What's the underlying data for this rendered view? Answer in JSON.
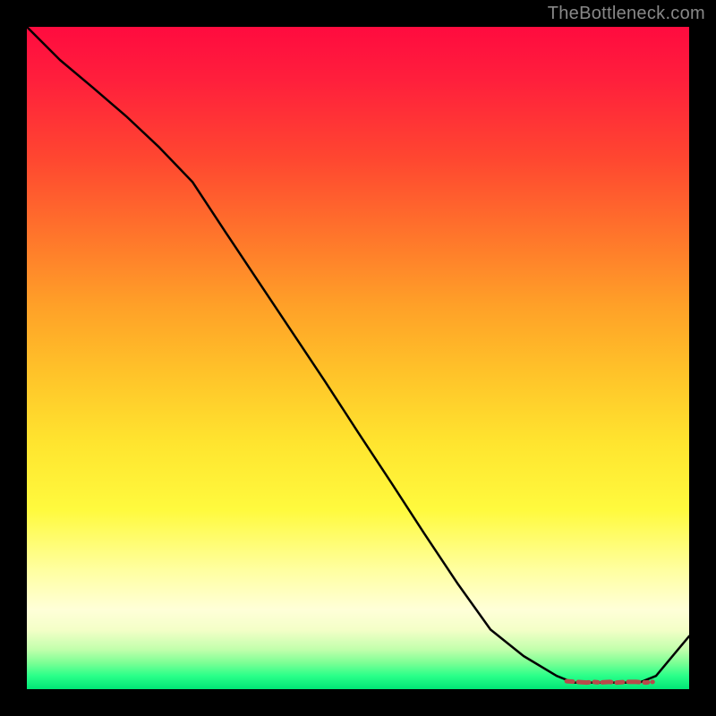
{
  "attribution": "TheBottleneck.com",
  "chart_data": {
    "type": "line",
    "title": "",
    "xlabel": "",
    "ylabel": "",
    "x": [
      0.0,
      0.05,
      0.1,
      0.15,
      0.2,
      0.25,
      0.3,
      0.35,
      0.4,
      0.45,
      0.5,
      0.55,
      0.6,
      0.65,
      0.7,
      0.75,
      0.8,
      0.825,
      0.85,
      0.875,
      0.9,
      0.925,
      0.95,
      1.0
    ],
    "values": [
      1.0,
      0.95,
      0.908,
      0.865,
      0.818,
      0.766,
      0.69,
      0.615,
      0.54,
      0.465,
      0.388,
      0.312,
      0.235,
      0.16,
      0.09,
      0.05,
      0.02,
      0.01,
      0.01,
      0.01,
      0.01,
      0.01,
      0.02,
      0.08
    ],
    "ylim": [
      0,
      1
    ],
    "xlim": [
      0,
      1
    ],
    "plateau": {
      "x": [
        0.815,
        0.83,
        0.845,
        0.855,
        0.865,
        0.88,
        0.89,
        0.905,
        0.92,
        0.935,
        0.945
      ],
      "y": [
        0.012,
        0.011,
        0.01,
        0.011,
        0.01,
        0.011,
        0.01,
        0.011,
        0.011,
        0.01,
        0.011
      ]
    },
    "gradient_stops": [
      {
        "offset": 0.0,
        "color": "#ff0b3f"
      },
      {
        "offset": 0.2,
        "color": "#ff4730"
      },
      {
        "offset": 0.42,
        "color": "#ffa028"
      },
      {
        "offset": 0.63,
        "color": "#ffe52f"
      },
      {
        "offset": 0.82,
        "color": "#ffffa0"
      },
      {
        "offset": 0.94,
        "color": "#c2ffac"
      },
      {
        "offset": 1.0,
        "color": "#00e676"
      }
    ]
  }
}
